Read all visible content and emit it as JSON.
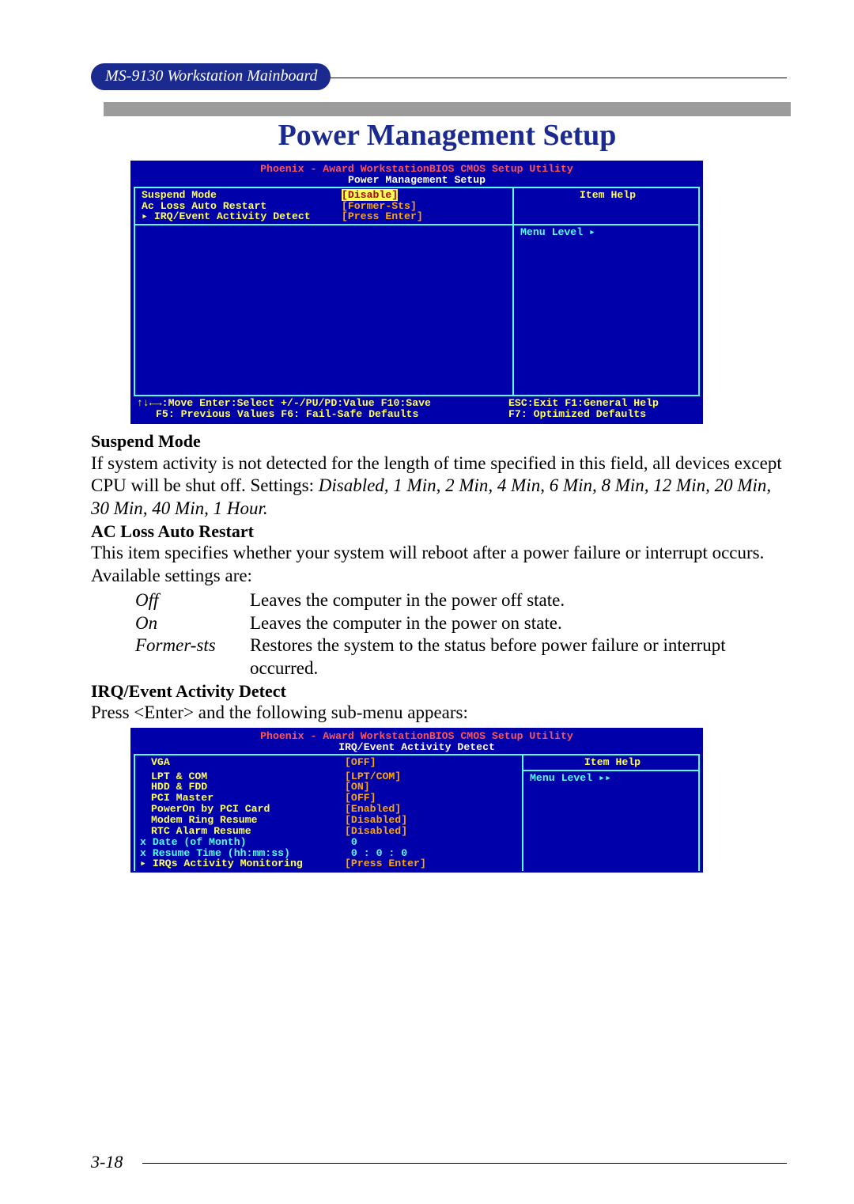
{
  "header": {
    "badge": "MS-9130 Workstation Mainboard"
  },
  "title": "Power Management Setup",
  "bios1": {
    "header_line1": "Phoenix - Award WorkstationBIOS CMOS Setup Utility",
    "header_line2": "Power Management Setup",
    "items": [
      {
        "label": "Suspend Mode",
        "value": "[Disable]",
        "hl": true
      },
      {
        "label": "Ac Loss Auto Restart",
        "value": "[Former-Sts]"
      },
      {
        "label": "▸ IRQ/Event Activity Detect",
        "value": "[Press Enter]"
      }
    ],
    "help_title": "Item Help",
    "menu_level": "Menu Level   ▸",
    "footer_l1_left": "↑↓←→:Move  Enter:Select  +/-/PU/PD:Value  F10:Save",
    "footer_l1_right": "ESC:Exit  F1:General Help",
    "footer_l2_left": "F5: Previous Values    F6: Fail-Safe Defaults",
    "footer_l2_right": "F7: Optimized Defaults"
  },
  "sections": {
    "suspend": {
      "heading": "Suspend Mode",
      "body": "If system activity is not detected for the length of time specified in this field, all devices except CPU will be shut off.  Settings: ",
      "settings_ital": "Disabled, 1 Min, 2 Min, 4 Min, 6 Min,  8 Min, 12 Min, 20 Min, 30 Min, 40 Min, 1 Hour."
    },
    "acloss": {
      "heading": "AC Loss Auto Restart",
      "body": "This item specifies whether your system will reboot after a power failure or interrupt occurs.  Available settings are:",
      "rows": [
        {
          "key": "Off",
          "val": "Leaves the computer in the power off state."
        },
        {
          "key": "On",
          "val": "Leaves the computer in the power on state."
        },
        {
          "key": "Former-sts",
          "val": "Restores the system to the status before power failure or interrupt occurred."
        }
      ]
    },
    "irq": {
      "heading": "IRQ/Event Activity Detect",
      "body": "Press <Enter> and the following sub-menu appears:"
    }
  },
  "bios2": {
    "header_line1": "Phoenix - Award WorkstationBIOS CMOS Setup Utility",
    "header_line2": "IRQ/Event Activity Detect",
    "items": [
      {
        "label": "VGA",
        "value": "[OFF]",
        "cls": "o"
      },
      {
        "label": "LPT & COM",
        "value": "[LPT/COM]",
        "cls": "o"
      },
      {
        "label": "HDD & FDD",
        "value": "[ON]",
        "cls": "o"
      },
      {
        "label": "PCI Master",
        "value": "[OFF]",
        "cls": "o"
      },
      {
        "label": "PowerOn by PCI Card",
        "value": "[Enabled]",
        "cls": "o"
      },
      {
        "label": "Modem Ring Resume",
        "value": "[Disabled]",
        "cls": "o"
      },
      {
        "label": "RTC Alarm Resume",
        "value": "[Disabled]",
        "cls": "o"
      },
      {
        "label": "x Date (of Month)",
        "value": "    0",
        "cls": "cy",
        "dim": true
      },
      {
        "label": "x Resume Time (hh:mm:ss)",
        "value": " 0 :  0 :  0",
        "cls": "cy",
        "dim": true
      },
      {
        "label": "▸ IRQs Activity Monitoring",
        "value": "[Press Enter]",
        "cls": "o"
      }
    ],
    "help_title": "Item Help",
    "menu_level": "Menu Level   ▸▸"
  },
  "page_number": "3-18"
}
